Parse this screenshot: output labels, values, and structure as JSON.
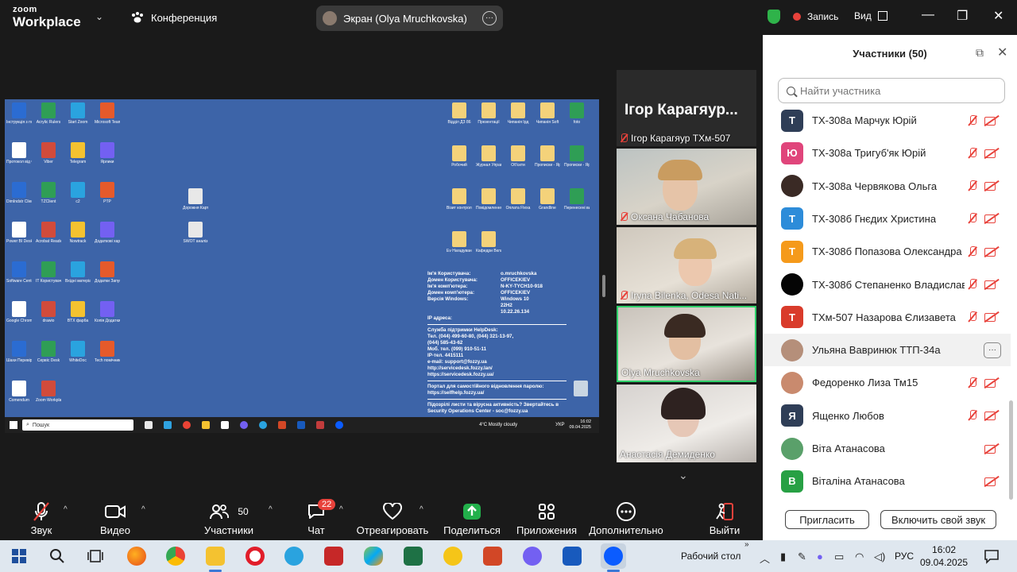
{
  "app": {
    "logo_top": "zoom",
    "logo_bottom": "Workplace",
    "meeting_label": "Конференция",
    "share_label": "Экран (Olya Mruchkovska)",
    "record_label": "Запись",
    "view_label": "Вид"
  },
  "shared_screen": {
    "icons_left": [
      "Інструкція з повернення",
      "Acrylic Rulers",
      "Start Zoom",
      "Microsoft Teams",
      "Протокол від Саші",
      "Viber",
      "Telegram",
      "Ярлики",
      "DimIndstr Client",
      "TZClient",
      "c2",
      "PTP",
      "Power BI Desktop",
      "Acrobat Reader",
      "Nowtrack",
      "Додаткові характер...",
      "Software Center",
      "IT Користувач",
      "Вхідні матеріали",
      "Додатки Запуск",
      "Google Chrome",
      "drawio",
      "BTX фарба",
      "Копія Додатки",
      "Шахи Перевірити",
      "Сервіс Desk",
      "WhiteDoc",
      "Tech помічник",
      "Comendum",
      "Zoom Workplace"
    ],
    "icons_right": [
      "Відділ ДЗ 86",
      "Презентації",
      "Чипанія Ірд",
      "Чипанія Soft",
      "foto",
      "Робочий",
      "Журнал Управлін...",
      "Об'єкти",
      "Прописки - Ярлик",
      "Прописки - Ярлик",
      "Візит контрол...",
      "Повідомлення щодо відсуп...",
      "Оплата Flexa",
      "Grandline",
      "Перенесені виплати",
      "Ev Нагадування",
      "Кафедри Вкладання"
    ],
    "icons_mid": [
      "Дорожня Карта",
      "SWOT аналіз"
    ],
    "info_rows": [
      {
        "k": "Ім'я Користувача:",
        "v": "o.mruchkovska"
      },
      {
        "k": "Домен Користувача:",
        "v": "OFFICEKIEV"
      },
      {
        "k": "Ім'я комп'ютера:",
        "v": "N-KY-TYCH10-918"
      },
      {
        "k": "Домен комп'ютера:",
        "v": "OFFICEKIEV"
      },
      {
        "k": "Версія Windows:",
        "v": "Windows 10"
      },
      {
        "k": "",
        "v": "22H2"
      },
      {
        "k": "",
        "v": "10.22.26.134"
      },
      {
        "k": "IP адреса:",
        "v": ""
      }
    ],
    "helpdesk_title": "Служба підтримки HelpDesk:",
    "helpdesk_lines": [
      "Тел. (044) 499-60-80, (044) 321-13-97,",
      "(044) 585-43-62",
      "Моб. тел. (099) 910-51-11",
      "IP-тел. 4415111",
      "e-mail: support@fozzy.ua",
      "http://servicedesk.fozzy.lan/",
      "https://servicedesk.fozzy.ua/"
    ],
    "portal_title": "Портал для самостійного відновлення паролю:",
    "portal_url": "https://selfhelp.fozzy.ua/",
    "soc_line1": "Підозрілі листи та вірусна активність? Звертайтесь в",
    "soc_line2": "Security Operations Center - soc@fozzy.ua",
    "taskbar_search": "Пошук",
    "weather": "4°C Mostly cloudy",
    "tray_lang": "УКР",
    "clock_time": "16:02",
    "clock_date": "09.04.2025"
  },
  "videos": [
    {
      "name": "Ігор Карагяур ТХм-507",
      "big": "Ігор Карагяур...",
      "muted": true
    },
    {
      "name": "Оксана Чабанова",
      "muted": true
    },
    {
      "name": "Iryna Bilenka, Odesa Nati...",
      "muted": true
    },
    {
      "name": "Olya Mruchkovska",
      "muted": false
    },
    {
      "name": "Анастасія Демиденко",
      "muted": false
    }
  ],
  "participants": {
    "title": "Участники (50)",
    "search_placeholder": "Найти участника",
    "list": [
      {
        "initial": "Т",
        "name": "ТХ-308а Марчук Юрій",
        "color": "#2f3e57",
        "mic": true,
        "cam": true
      },
      {
        "initial": "Ю",
        "name": "ТХ-308а Тригуб'як Юрій",
        "color": "#e0457b",
        "mic": true,
        "cam": true
      },
      {
        "initial": "",
        "name": "ТХ-308а Червякова Ольга",
        "color": "#3a2a25",
        "mic": true,
        "cam": true
      },
      {
        "initial": "Т",
        "name": "ТХ-308б Гнєдих Христина",
        "color": "#2d8cd9",
        "mic": true,
        "cam": true
      },
      {
        "initial": "Т",
        "name": "ТХ-308б Попазова Олександра",
        "color": "#f59a1b",
        "mic": true,
        "cam": true
      },
      {
        "initial": "",
        "name": "ТХ-308б Степаненко Владислав",
        "color": "#050505",
        "mic": true,
        "cam": true
      },
      {
        "initial": "Т",
        "name": "ТХм-507 Назарова Єлизавета",
        "color": "#d93b2b",
        "mic": true,
        "cam": true
      },
      {
        "initial": "",
        "name": "Ульяна Вавринюк ТТП-34а",
        "color": "#b58f7a",
        "mic": false,
        "cam": false,
        "more": "···"
      },
      {
        "initial": "",
        "name": "Федоренко Лиза Тм15",
        "color": "#c98a6e",
        "mic": true,
        "cam": true
      },
      {
        "initial": "Я",
        "name": "Ященко Любов",
        "color": "#2f3e57",
        "mic": true,
        "cam": true
      },
      {
        "initial": "",
        "name": "Віта Атанасова",
        "color": "#5aa06a",
        "mic": false,
        "cam": true
      },
      {
        "initial": "В",
        "name": "Віталіна Атанасова",
        "color": "#27a044",
        "mic": false,
        "cam": true
      }
    ],
    "invite_label": "Пригласить",
    "unmute_label": "Включить свой звук"
  },
  "toolbar": {
    "audio": "Звук",
    "video": "Видео",
    "participants": "Участники",
    "participants_count": "50",
    "chat": "Чат",
    "chat_badge": "22",
    "react": "Отреагировать",
    "share": "Поделиться",
    "apps": "Приложения",
    "more": "Дополнительно",
    "leave": "Выйти"
  },
  "windows_taskbar": {
    "desktop_label": "Рабочий стол",
    "lang": "РУС",
    "time": "16:02",
    "date": "09.04.2025"
  },
  "colors": {
    "accent_green": "#2fd06a",
    "alert_red": "#e8423b",
    "share_green": "#22b04b",
    "zoom_blue": "#0b5cff"
  }
}
